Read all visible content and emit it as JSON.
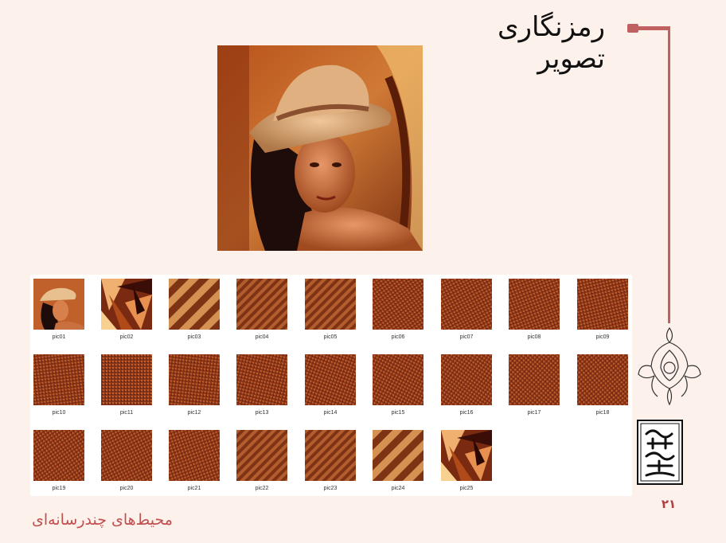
{
  "slide": {
    "title": "رمزنگاری تصویر",
    "footer": "محیط‌های چندرسانه‌ای",
    "page_number": "۲۱"
  },
  "colors": {
    "background": "#fdf1eb",
    "accent_line": "#c06060",
    "footer_text": "#c05050",
    "thumb_base": "#8a3a18"
  },
  "thumbnails": [
    {
      "label": "pic01",
      "kind": "photo"
    },
    {
      "label": "pic02",
      "kind": "shards"
    },
    {
      "label": "pic03",
      "kind": "diagonal-wide"
    },
    {
      "label": "pic04",
      "kind": "diagonal"
    },
    {
      "label": "pic05",
      "kind": "diagonal"
    },
    {
      "label": "pic06",
      "kind": "texture"
    },
    {
      "label": "pic07",
      "kind": "texture"
    },
    {
      "label": "pic08",
      "kind": "texture"
    },
    {
      "label": "pic09",
      "kind": "texture"
    },
    {
      "label": "pic10",
      "kind": "texture"
    },
    {
      "label": "pic11",
      "kind": "texture"
    },
    {
      "label": "pic12",
      "kind": "texture"
    },
    {
      "label": "pic13",
      "kind": "texture"
    },
    {
      "label": "pic14",
      "kind": "texture"
    },
    {
      "label": "pic15",
      "kind": "texture"
    },
    {
      "label": "pic16",
      "kind": "texture"
    },
    {
      "label": "pic17",
      "kind": "texture"
    },
    {
      "label": "pic18",
      "kind": "texture"
    },
    {
      "label": "pic19",
      "kind": "texture"
    },
    {
      "label": "pic20",
      "kind": "texture"
    },
    {
      "label": "pic21",
      "kind": "texture"
    },
    {
      "label": "pic22",
      "kind": "diagonal"
    },
    {
      "label": "pic23",
      "kind": "diagonal"
    },
    {
      "label": "pic24",
      "kind": "diagonal-wide"
    },
    {
      "label": "pic25",
      "kind": "shards"
    }
  ]
}
